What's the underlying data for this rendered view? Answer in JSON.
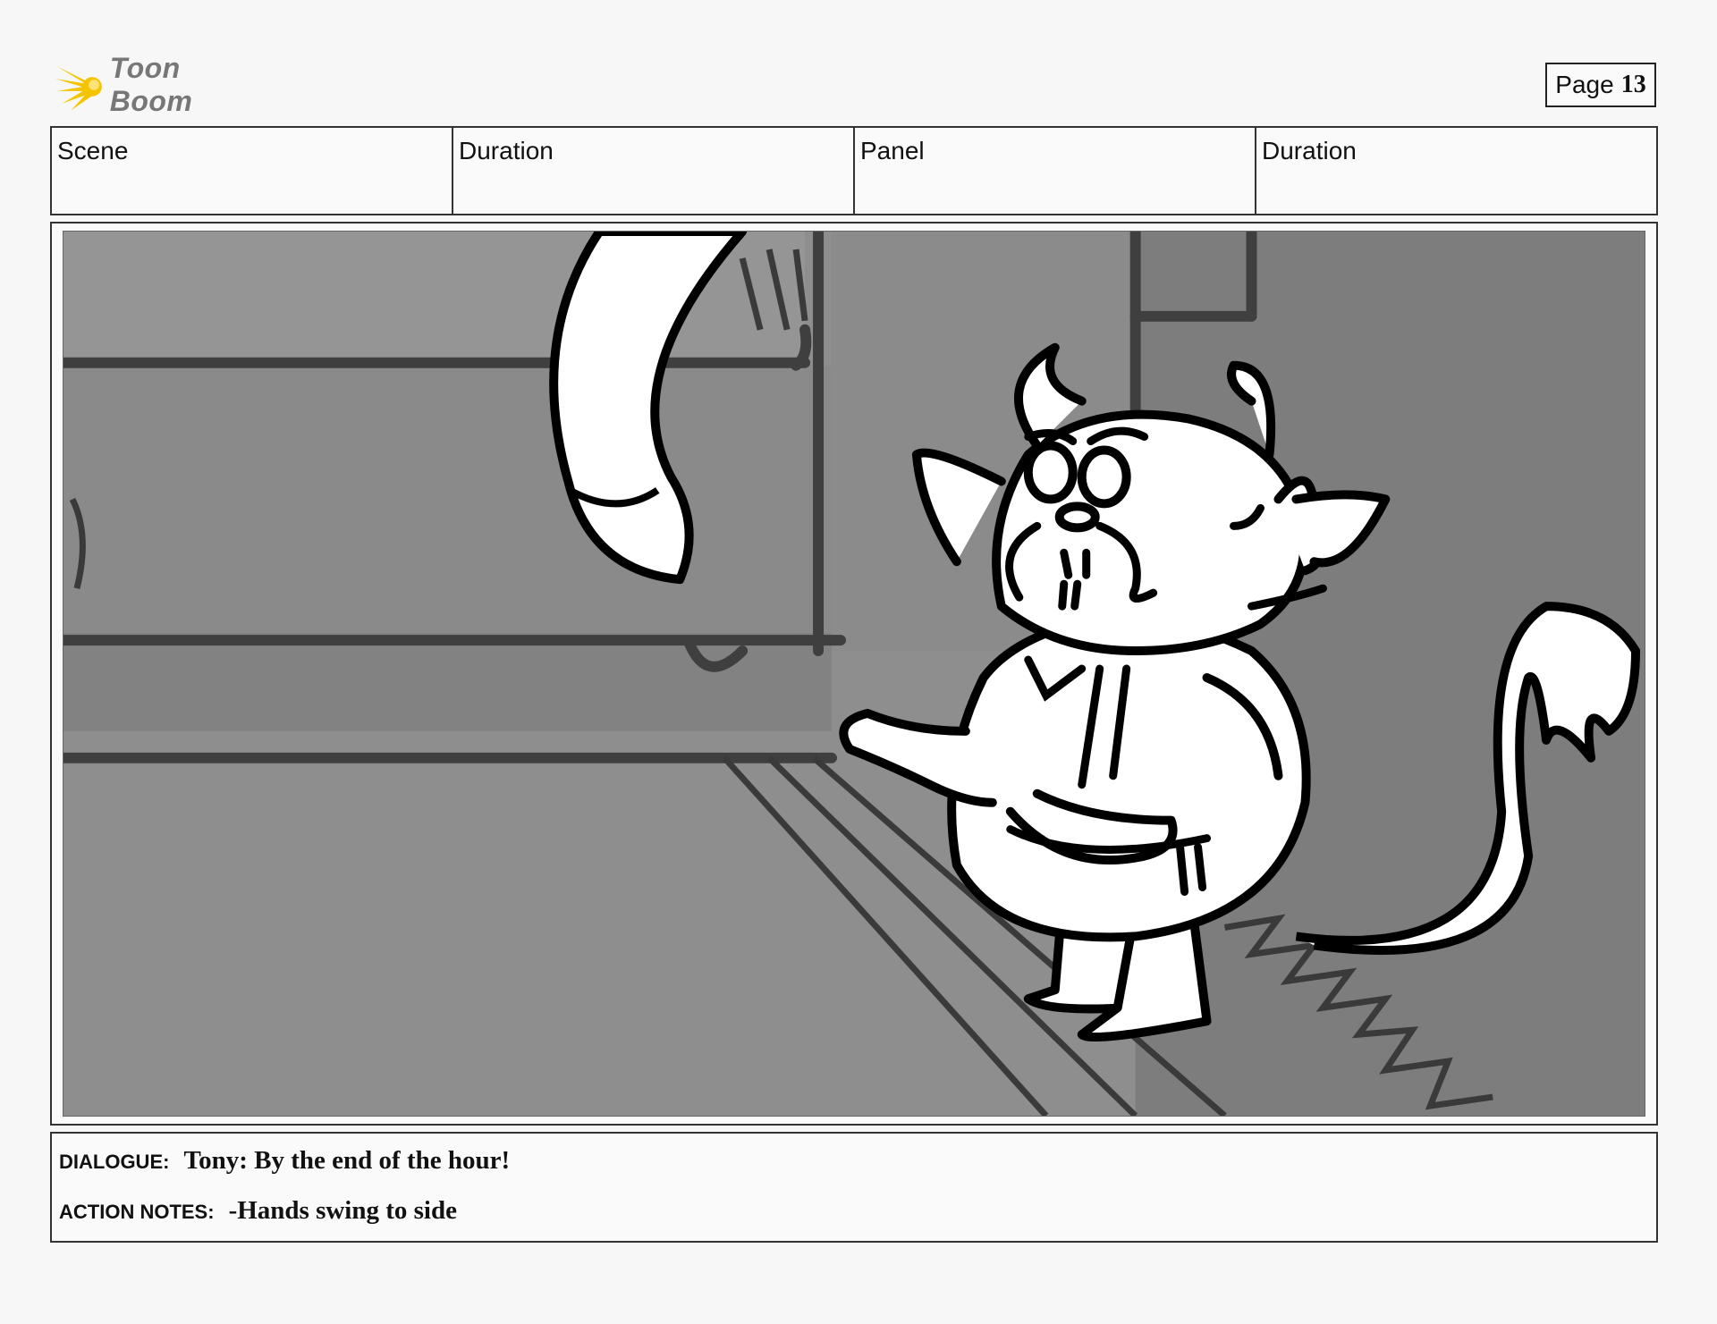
{
  "brand": {
    "name": "Toon Boom",
    "icon": "starburst-logo-icon",
    "accent": "#f5c400"
  },
  "page": {
    "label": "Page",
    "number": "13"
  },
  "header": {
    "columns": [
      "Scene",
      "Duration",
      "Panel",
      "Duration"
    ]
  },
  "panel": {
    "image": "storyboard-sketch-image"
  },
  "notes": {
    "dialogue_label": "DIALOGUE:",
    "dialogue_text": "Tony: By the end of the hour!",
    "action_label": "ACTION NOTES:",
    "action_text": "-Hands swing to side"
  }
}
